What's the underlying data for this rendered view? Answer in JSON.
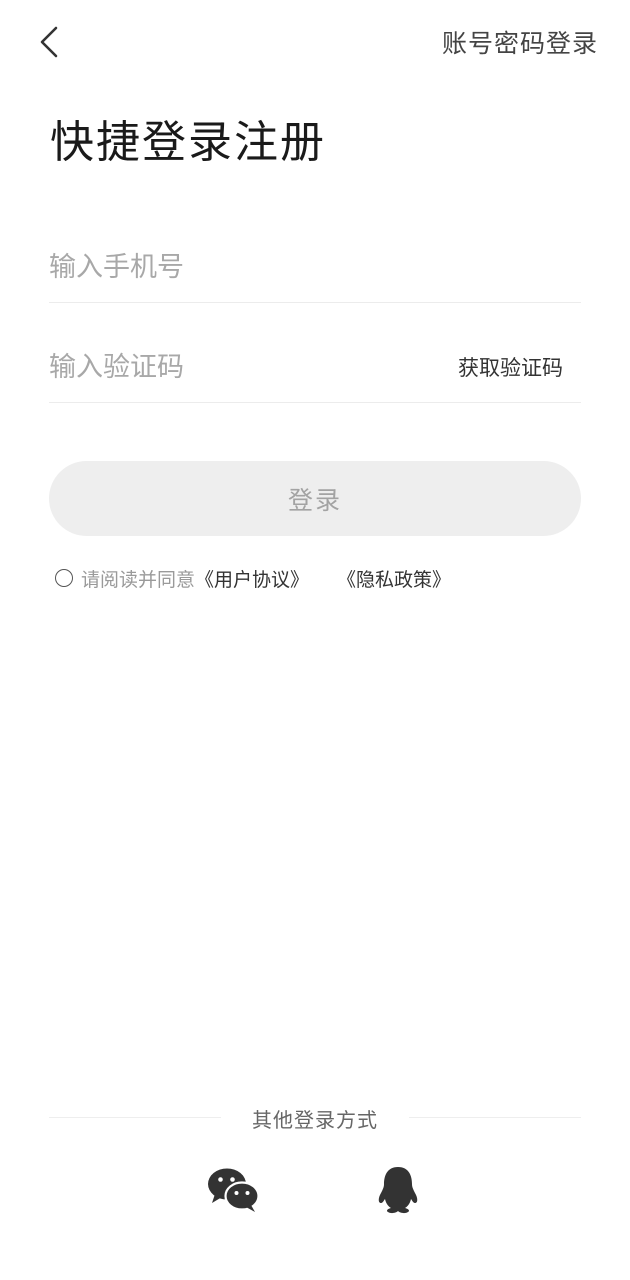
{
  "header": {
    "back_icon": "back-arrow-icon",
    "password_login_label": "账号密码登录"
  },
  "main": {
    "title": "快捷登录注册",
    "phone_input": {
      "value": "",
      "placeholder": "输入手机号"
    },
    "code_input": {
      "value": "",
      "placeholder": "输入验证码"
    },
    "get_code_label": "获取验证码",
    "login_button_label": "登录",
    "agreement": {
      "checked": false,
      "prefix": "请阅读并同意",
      "user_agreement": "《用户协议》",
      "privacy_policy": "《隐私政策》"
    }
  },
  "footer": {
    "other_login_label": "其他登录方式",
    "social_icons": [
      "wechat-icon",
      "qq-icon"
    ]
  },
  "colors": {
    "background": "#ffffff",
    "login_button_bg": "#eeeeee",
    "login_button_text": "#a3a3a3",
    "placeholder": "#a8a8a8",
    "divider": "#ececec",
    "icon": "#333333"
  }
}
